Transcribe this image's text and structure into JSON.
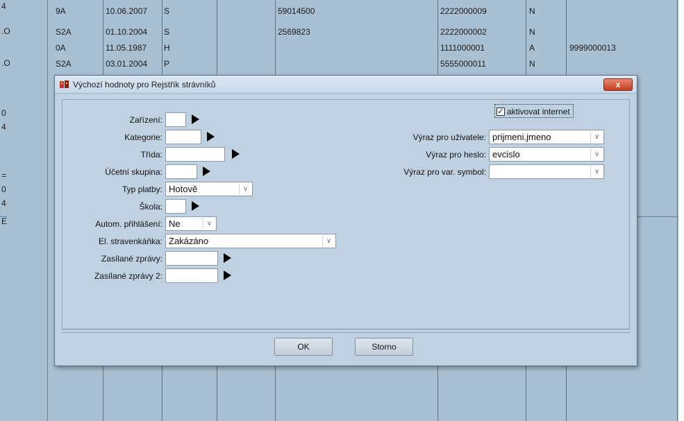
{
  "background": {
    "left_labels": [
      "4",
      ".O",
      ".O",
      "0",
      "4",
      "=",
      "0",
      "4",
      "E"
    ],
    "rows": [
      {
        "code": "9A",
        "date": "10.06.2007",
        "flag": "S",
        "num": "59014500",
        "id": "2222000009",
        "status": "N",
        "extra": ""
      },
      {
        "code": "S2A",
        "date": "01.10.2004",
        "flag": "S",
        "num": "2569823",
        "id": "2222000002",
        "status": "N",
        "extra": ""
      },
      {
        "code": "0A",
        "date": "11.05.1987",
        "flag": "H",
        "num": "",
        "id": "1111000001",
        "status": "A",
        "extra": "9999000013"
      },
      {
        "code": "S2A",
        "date": "03.01.2004",
        "flag": "P",
        "num": "",
        "id": "5555000011",
        "status": "N",
        "extra": ""
      }
    ]
  },
  "dialog": {
    "title": "Výchozí hodnoty pro Rejstřík strávníků",
    "close_label": "x",
    "left_fields": [
      {
        "label": "Zařízení:",
        "type": "text",
        "value": ""
      },
      {
        "label": "Kategorie:",
        "type": "text",
        "value": ""
      },
      {
        "label": "Třída:",
        "type": "text",
        "value": ""
      },
      {
        "label": "Účetní skupina:",
        "type": "text",
        "value": ""
      },
      {
        "label": "Typ platby:",
        "type": "select",
        "value": "Hotově"
      },
      {
        "label": "Škola:",
        "type": "text",
        "value": ""
      },
      {
        "label": "Autom. přihlášení:",
        "type": "select",
        "value": "Ne"
      },
      {
        "label": "El. stravenkáňka:",
        "type": "select",
        "value": "Zakázáno"
      },
      {
        "label": "Zasílané zprávy:",
        "type": "text",
        "value": ""
      },
      {
        "label": "Zasílané zprávy 2:",
        "type": "text",
        "value": ""
      }
    ],
    "checkbox": {
      "label": "aktivovat internet",
      "checked": true
    },
    "right_fields": [
      {
        "label": "Výraz pro uživatele:",
        "value": "prijmeni.jmeno"
      },
      {
        "label": "Výraz pro heslo:",
        "value": "evcislo"
      },
      {
        "label": "Výraz pro var. symbol:",
        "value": ""
      }
    ],
    "ok_label": "OK",
    "cancel_label": "Storno"
  }
}
